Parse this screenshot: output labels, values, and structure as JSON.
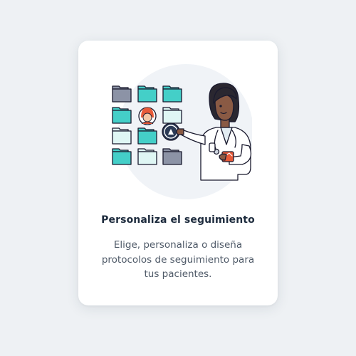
{
  "card": {
    "title": "Personaliza el seguimiento",
    "description": "Elige, personaliza o diseña protocolos de seguimiento para tus pacientes."
  },
  "illustration": {
    "icon": "doctor-with-folders-illustration",
    "folder_colors": {
      "teal": "#44cfc8",
      "light": "#dff6f4",
      "gray": "#8c93a6"
    }
  },
  "colors": {
    "background": "#eef1f4",
    "card": "#ffffff",
    "title": "#1d2b3d",
    "text": "#4f5a68"
  }
}
